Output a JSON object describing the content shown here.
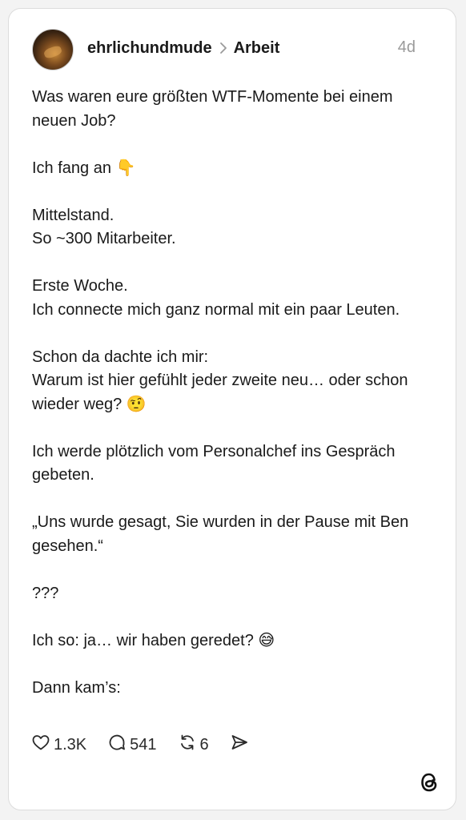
{
  "post": {
    "username": "ehrlichundmude",
    "community": "Arbeit",
    "age": "4d",
    "paragraphs": [
      "Was waren eure größten WTF-Momente bei einem neuen Job?",
      "Ich fang an 👇",
      "Mittelstand.\nSo ~300 Mitarbeiter.",
      "Erste Woche.\nIch connecte mich ganz normal mit ein paar Leuten.",
      "Schon da dachte ich mir:\nWarum ist hier gefühlt jeder zweite neu… oder schon wieder weg? 🤨",
      "Ich werde plötzlich vom Personalchef ins Gespräch gebeten.",
      "„Uns wurde gesagt, Sie wurden in der Pause mit Ben gesehen.“",
      "???",
      "Ich so: ja… wir haben geredet? 😅",
      "Dann kam’s:"
    ]
  },
  "actions": {
    "likes": "1.3K",
    "replies": "541",
    "reposts": "6"
  },
  "icons": {
    "separator": "chevron-right-icon",
    "like": "heart-icon",
    "reply": "speech-bubble-icon",
    "repost": "repost-icon",
    "share": "send-icon",
    "brand": "threads-logo-icon"
  }
}
